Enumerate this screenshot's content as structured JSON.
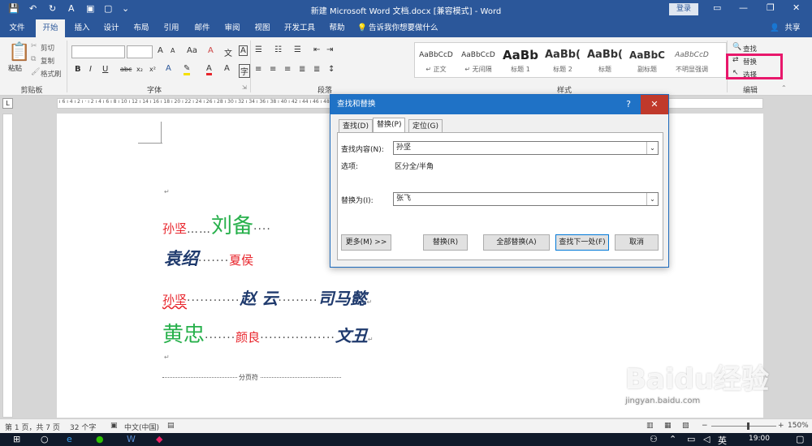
{
  "window": {
    "title": "新建 Microsoft Word 文档.docx [兼容模式] - Word",
    "login_label": "登录",
    "share_label": "共享",
    "tell_me": "告诉我你想要做什么"
  },
  "menu_tabs": [
    "文件",
    "开始",
    "插入",
    "设计",
    "布局",
    "引用",
    "邮件",
    "审阅",
    "视图",
    "开发工具",
    "帮助"
  ],
  "ribbon": {
    "clipboard": {
      "paste": "粘贴",
      "cut": "剪切",
      "copy": "复制",
      "format_painter": "格式刷",
      "label": "剪贴板"
    },
    "font": {
      "label": "字体",
      "bold": "B",
      "italic": "I",
      "underline": "U",
      "strike": "abc",
      "sub": "x₂",
      "sup": "x²"
    },
    "paragraph": {
      "label": "段落"
    },
    "styles": {
      "label": "样式",
      "items": [
        {
          "sample": "AaBbCcD",
          "name": "↵ 正文"
        },
        {
          "sample": "AaBbCcD",
          "name": "↵ 无间隔"
        },
        {
          "sample": "AaBb",
          "name": "标题 1"
        },
        {
          "sample": "AaBb(",
          "name": "标题 2"
        },
        {
          "sample": "AaBb(",
          "name": "标题"
        },
        {
          "sample": "AaBbC",
          "name": "副标题"
        },
        {
          "sample": "AaBbCcD",
          "name": "不明显强调"
        }
      ]
    },
    "editing": {
      "find": "查找",
      "replace": "替换",
      "select": "选择",
      "label": "编辑"
    }
  },
  "document": {
    "lines": [
      [
        {
          "t": "孙坚",
          "c": "red"
        },
        {
          "t": "……",
          "c": "dots"
        },
        {
          "t": "刘备",
          "c": "green"
        },
        {
          "t": "····",
          "c": "dots"
        }
      ],
      [
        {
          "t": "袁绍",
          "c": "navy"
        },
        {
          "t": "·······",
          "c": "dots"
        },
        {
          "t": "夏侯",
          "c": "red"
        }
      ],
      [
        {
          "t": "孙坚",
          "c": "red"
        },
        {
          "t": "············",
          "c": "dots"
        },
        {
          "t": "赵 云",
          "c": "navy"
        },
        {
          "t": "·········",
          "c": "dots"
        },
        {
          "t": "司马懿",
          "c": "navy"
        }
      ],
      [
        {
          "t": "黄忠",
          "c": "green"
        },
        {
          "t": "·······",
          "c": "dots"
        },
        {
          "t": "颜良",
          "c": "red"
        },
        {
          "t": "·················",
          "c": "dots"
        },
        {
          "t": "文丑",
          "c": "navy"
        }
      ]
    ],
    "page_break_label": "分页符"
  },
  "dialog": {
    "title": "查找和替换",
    "help": "?",
    "tabs": [
      "查找(D)",
      "替换(P)",
      "定位(G)"
    ],
    "find_label": "查找内容(N):",
    "find_value": "孙坚",
    "options_label": "选项:",
    "options_value": "区分全/半角",
    "replace_label": "替换为(I):",
    "replace_value": "张飞",
    "buttons": {
      "more": "更多(M) >>",
      "replace": "替换(R)",
      "replace_all": "全部替换(A)",
      "find_next": "查找下一处(F)",
      "cancel": "取消"
    }
  },
  "statusbar": {
    "page": "第 1 页，共 7 页",
    "words": "32 个字",
    "lang": "中文(中国)",
    "zoom": "150%"
  },
  "taskbar": {
    "time": "19:00"
  },
  "watermark": {
    "text": "Baidu经验",
    "sub": "jingyan.baidu.com"
  }
}
